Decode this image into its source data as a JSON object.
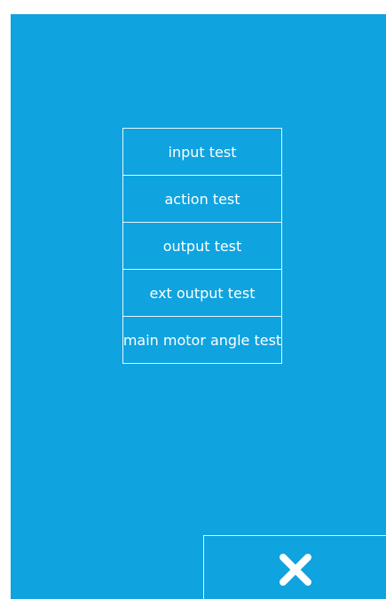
{
  "menu": {
    "items": [
      {
        "label": "input test"
      },
      {
        "label": "action test"
      },
      {
        "label": "output test"
      },
      {
        "label": "ext output test"
      },
      {
        "label": "main motor angle test"
      }
    ]
  },
  "close_button": {
    "icon": "close-icon"
  },
  "colors": {
    "background": "#0fa3df",
    "border": "#e8f6fd",
    "text": "#ffffff"
  }
}
